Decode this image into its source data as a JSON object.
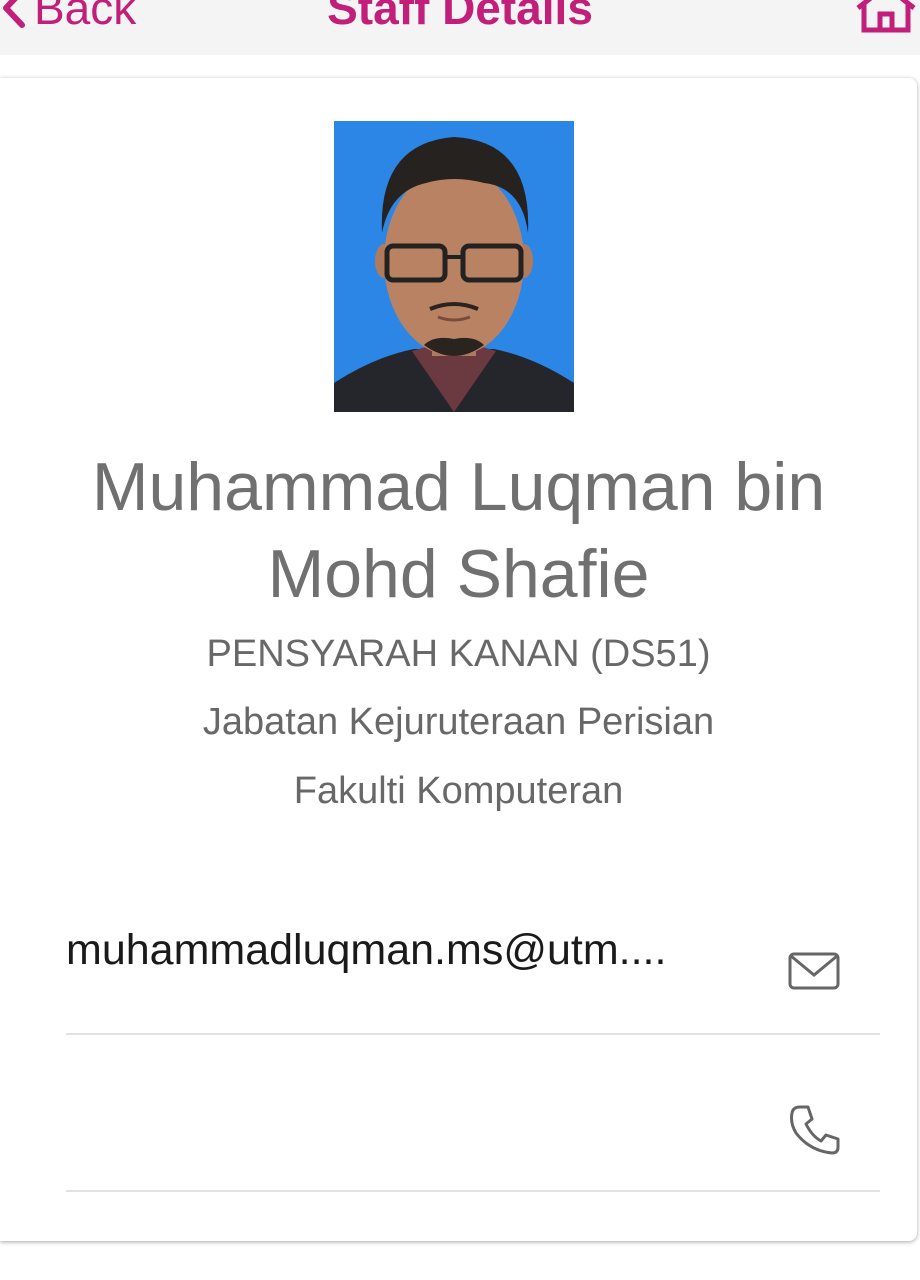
{
  "header": {
    "back_label": "Back",
    "title": "Staff Details"
  },
  "staff": {
    "name": "Muhammad Luqman bin Mohd Shafie",
    "position": "PENSYARAH KANAN (DS51)",
    "department": "Jabatan Kejuruteraan Perisian",
    "faculty": "Fakulti Komputeran",
    "email": "muhammadluqman.ms@utm....",
    "phone": ""
  },
  "icons": {
    "back": "chevron-left-icon",
    "home": "home-icon",
    "email": "mail-icon",
    "phone": "phone-icon"
  },
  "colors": {
    "accent": "#c21f7a",
    "photo_background": "#2c86e6",
    "text_grey": "#707070"
  }
}
